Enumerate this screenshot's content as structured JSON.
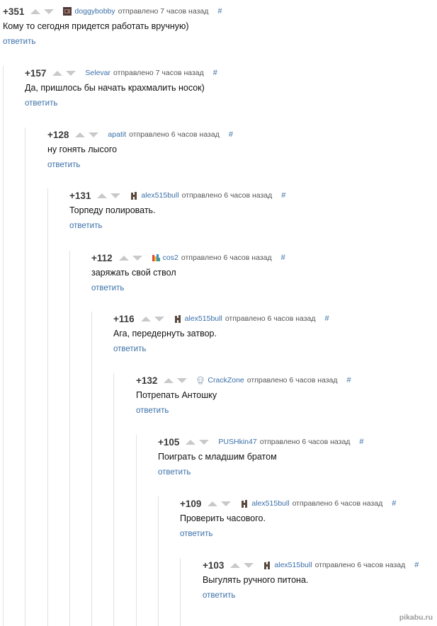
{
  "comments": [
    {
      "score": "+351",
      "user": "doggybobby",
      "meta": "отправлено 7 часов назад",
      "hash": "#",
      "text": "Кому то сегодня придется работать вручную)",
      "reply": "ответить",
      "avatar": "photo"
    },
    {
      "score": "+157",
      "user": "Selevar",
      "meta": "отправлено 7 часов назад",
      "hash": "#",
      "text": "Да, пришлось бы начать крахмалить носок)",
      "reply": "ответить",
      "avatar": "none"
    },
    {
      "score": "+128",
      "user": "apatit",
      "meta": "отправлено 6 часов назад",
      "hash": "#",
      "text": "ну гонять лысого",
      "reply": "ответить",
      "avatar": "none"
    },
    {
      "score": "+131",
      "user": "alex515bull",
      "meta": "отправлено 6 часов назад",
      "hash": "#",
      "text": "Торпеду полировать.",
      "reply": "ответить",
      "avatar": "horse"
    },
    {
      "score": "+112",
      "user": "cos2",
      "meta": "отправлено 6 часов назад",
      "hash": "#",
      "text": "заряжать свой ствол",
      "reply": "ответить",
      "avatar": "colorful"
    },
    {
      "score": "+116",
      "user": "alex515bull",
      "meta": "отправлено 6 часов назад",
      "hash": "#",
      "text": "Ага, передернуть затвор.",
      "reply": "ответить",
      "avatar": "horse"
    },
    {
      "score": "+132",
      "user": "CrackZone",
      "meta": "отправлено 6 часов назад",
      "hash": "#",
      "text": "Потрепать Антошку",
      "reply": "ответить",
      "avatar": "skull"
    },
    {
      "score": "+105",
      "user": "PUSHkin47",
      "meta": "отправлено 6 часов назад",
      "hash": "#",
      "text": "Поиграть с младшим братом",
      "reply": "ответить",
      "avatar": "none"
    },
    {
      "score": "+109",
      "user": "alex515bull",
      "meta": "отправлено 6 часов назад",
      "hash": "#",
      "text": "Проверить часового.",
      "reply": "ответить",
      "avatar": "horse"
    },
    {
      "score": "+103",
      "user": "alex515bull",
      "meta": "отправлено 6 часов назад",
      "hash": "#",
      "text": "Выгулять ручного питона.",
      "reply": "ответить",
      "avatar": "horse"
    }
  ],
  "watermark": "pikabu.ru"
}
